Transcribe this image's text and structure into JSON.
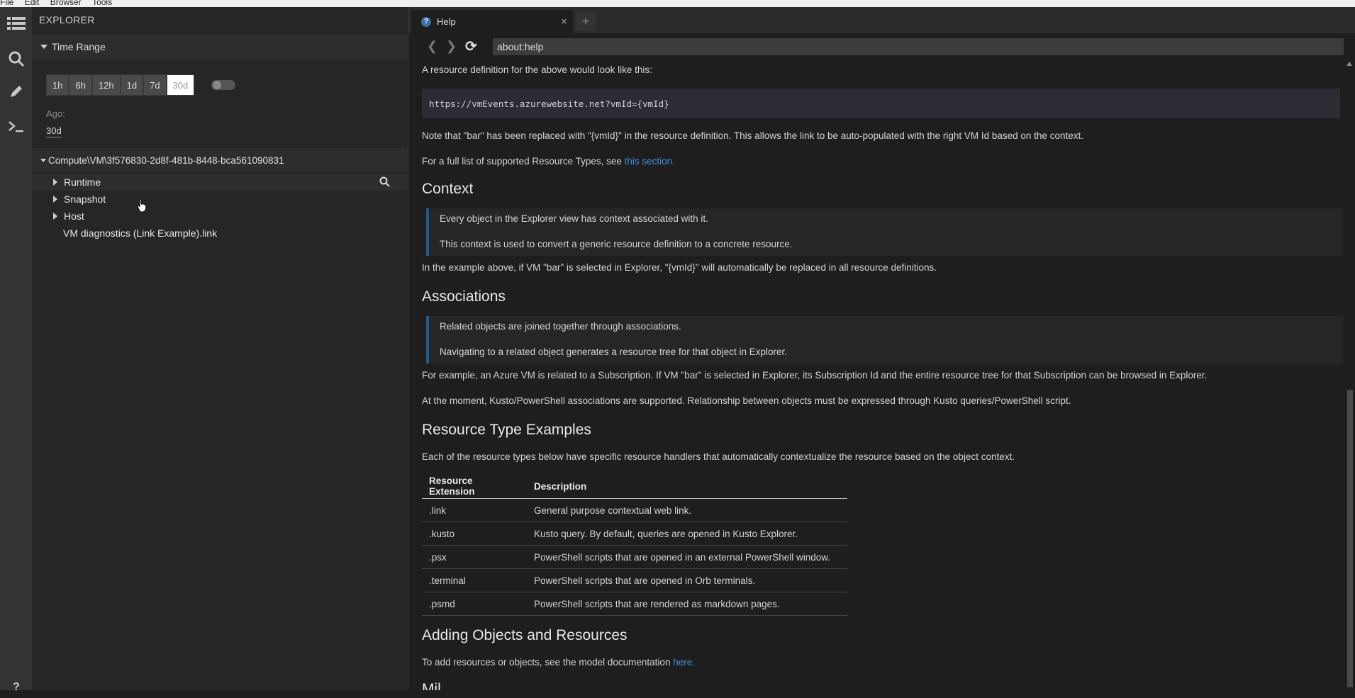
{
  "menubar": {
    "items": [
      "File",
      "Edit",
      "Browser",
      "Tools"
    ]
  },
  "activity": {
    "icons": [
      "explorer-list-icon",
      "search-icon",
      "pencil-icon",
      "terminal-icon",
      "help-icon"
    ],
    "help_glyph": "?"
  },
  "explorer": {
    "title": "EXPLORER",
    "time_range": {
      "header": "Time Range",
      "buttons": [
        "1h",
        "6h",
        "12h",
        "1d",
        "7d",
        "30d"
      ],
      "active": "30d",
      "ago_label": "Ago:",
      "ago_value": "30d"
    },
    "tree": {
      "root": "Compute\\VM\\3f576830-2d8f-481b-8448-bca561090831",
      "items": [
        "Runtime",
        "Snapshot",
        "Host",
        "VM diagnostics (Link Example).link"
      ]
    }
  },
  "tabs": {
    "active_label": "Help",
    "help_icon_glyph": "?",
    "close_glyph": "×",
    "new_tab_glyph": "+"
  },
  "nav": {
    "url": "about:help",
    "back_glyph": "❮",
    "forward_glyph": "❯",
    "refresh_glyph": "⟳"
  },
  "content": {
    "p_resource_def": "A resource definition for the above would look like this:",
    "code": "https://vmEvents.azurewebsite.net?vmId={vmId}",
    "p_note": "Note that \"bar\" has been replaced with \"{vmId}\" in the resource definition. This allows the link to be auto-populated with the right VM Id based on the context.",
    "p_full_list": "For a full list of supported Resource Types, see ",
    "link_this_section": "this section.",
    "h_context": "Context",
    "q_context_1": "Every object in the Explorer view has context associated with it.",
    "q_context_2": "This context is used to convert a generic resource definition to a concrete resource.",
    "p_example_above": "In the example above, if VM \"bar\" is selected in Explorer, \"{vmId}\" will automatically be replaced in all resource definitions.",
    "h_associations": "Associations",
    "q_assoc_1": "Related objects are joined together through associations.",
    "q_assoc_2": "Navigating to a related object generates a resource tree for that object in Explorer.",
    "p_for_example": "For example, an Azure VM is related to a Subscription. If VM \"bar\" is selected in Explorer, its Subscription Id and the entire resource tree for that Subscription can be browsed in Explorer.",
    "p_at_the_moment": "At the moment, Kusto/PowerShell associations are supported. Relationship between objects must be expressed through Kusto queries/PowerShell script.",
    "h_resource_types": "Resource Type Examples",
    "p_each": "Each of the resource types below have specific resource handlers that automatically contextualize the resource based on the object context.",
    "table": {
      "headers": [
        "Resource Extension",
        "Description"
      ],
      "rows": [
        [
          ".link",
          "General purpose contextual web link."
        ],
        [
          ".kusto",
          "Kusto query. By default, queries are opened in Kusto Explorer."
        ],
        [
          ".psx",
          "PowerShell scripts that are opened in an external PowerShell window."
        ],
        [
          ".terminal",
          "PowerShell scripts that are opened in Orb terminals."
        ],
        [
          ".psmd",
          "PowerShell scripts that are rendered as markdown pages."
        ]
      ]
    },
    "h_adding": "Adding Objects and Resources",
    "p_to_add": "To add resources or objects, see the model documentation ",
    "link_here": "here.",
    "h_partial": "Mil"
  },
  "colors": {
    "accent_link": "#3f8ed8",
    "quote_border": "#1e5a8a",
    "background": "#1e1e1e"
  }
}
